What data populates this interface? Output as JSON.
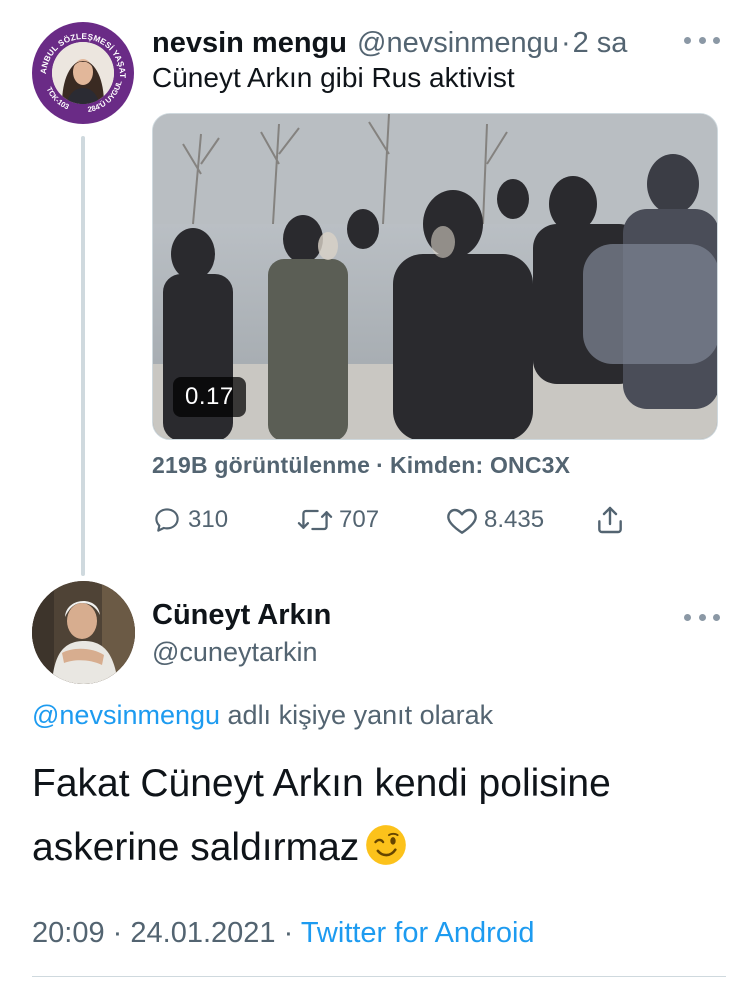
{
  "tweet1": {
    "display_name": "nevsin mengu",
    "handle": "@nevsinmengu",
    "separator": "·",
    "time": "2 sa",
    "text": "Cüneyt Arkın gibi Rus aktivist",
    "avatar_badge_top": "İSTANBUL SÖZLEŞMESİ YAŞATIR",
    "avatar_badge_left": "TCK-103",
    "avatar_badge_right": "6284'Ü UYGULA",
    "avatar_ring_color": "#6a2b86",
    "video_duration": "0.17",
    "views_text": "219B görüntülenme",
    "views_separator": "·",
    "source_text": "Kimden: ONC3X",
    "replies": "310",
    "retweets": "707",
    "likes": "8.435",
    "icons": [
      "more-icon",
      "reply-icon",
      "retweet-icon",
      "like-icon",
      "share-icon"
    ]
  },
  "tweet2": {
    "display_name": "Cüneyt Arkın",
    "handle": "@cuneytarkin",
    "reply_to_mention": "@nevsinmengu",
    "reply_to_suffix": "adlı kişiye yanıt olarak",
    "text_line1": "Fakat Cüneyt Arkın kendi polisine",
    "text_line2": "askerine saldırmaz",
    "emoji": "winking-face",
    "time": "20:09",
    "meta_separator": "·",
    "date": "24.01.2021",
    "source": "Twitter for Android"
  },
  "colors": {
    "link_blue": "#1d9bf0",
    "secondary_text": "#536471",
    "primary_text": "#0f1419",
    "divider": "#cfd9de"
  }
}
